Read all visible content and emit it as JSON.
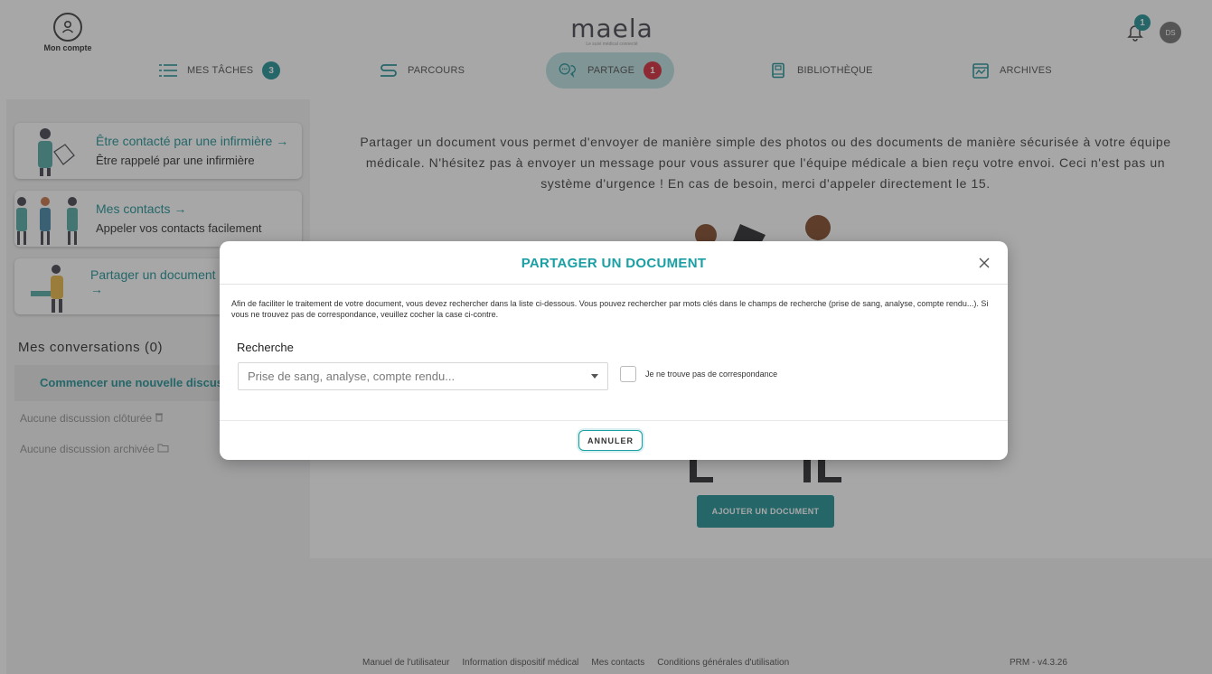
{
  "header": {
    "account_label": "Mon compte",
    "logo_text": "maela",
    "logo_subtitle": "Le suivi médical connecté",
    "notification_count": "1",
    "avatar_initials": "DS"
  },
  "nav": {
    "tasks": {
      "label": "MES TÂCHES",
      "badge": "3"
    },
    "journeys": {
      "label": "PARCOURS"
    },
    "share": {
      "label": "PARTAGE",
      "badge": "1"
    },
    "library": {
      "label": "BIBLIOTHÈQUE"
    },
    "archives": {
      "label": "ARCHIVES"
    }
  },
  "sidebar": {
    "cards": [
      {
        "title": "Être contacté par une infirmière →",
        "subtitle": "Être rappelé par une infirmière"
      },
      {
        "title": "Mes contacts →",
        "subtitle": "Appeler vos contacts facilement"
      },
      {
        "title": "Partager un document ou",
        "subtitle": "→"
      }
    ],
    "conversations_title": "Mes conversations (0)",
    "new_discussion": "Commencer une nouvelle discussi",
    "closed": "Aucune discussion clôturée",
    "archived": "Aucune discussion archivée"
  },
  "main": {
    "intro": "Partager un document vous permet d'envoyer de manière simple des photos ou des documents de manière sécurisée à votre équipe médicale. N'hésitez pas à envoyer un message pour vous assurer que l'équipe médicale a bien reçu votre envoi. Ceci n'est pas un système d'urgence ! En cas de besoin, merci d'appeler directement le 15.",
    "add_document": "AJOUTER UN DOCUMENT"
  },
  "modal": {
    "title": "PARTAGER UN DOCUMENT",
    "description": "Afin de faciliter le traitement de votre document, vous devez rechercher dans la liste ci-dessous. Vous pouvez rechercher par mots clés dans le champs de recherche (prise de sang, analyse, compte rendu...). Si vous ne trouvez pas de correspondance, veuillez cocher la case ci-contre.",
    "search_label": "Recherche",
    "search_placeholder": "Prise de sang, analyse, compte rendu...",
    "no_match_label": "Je ne trouve pas de correspondance",
    "cancel": "ANNULER"
  },
  "footer": {
    "links": [
      "Manuel de l'utilisateur",
      "Information dispositif médical",
      "Mes contacts",
      "Conditions générales d'utilisation"
    ],
    "version": "PRM - v4.3.26"
  },
  "colors": {
    "teal": "#138a8f",
    "teal_light": "#b9dfe0",
    "red_badge": "#d11c2d"
  }
}
